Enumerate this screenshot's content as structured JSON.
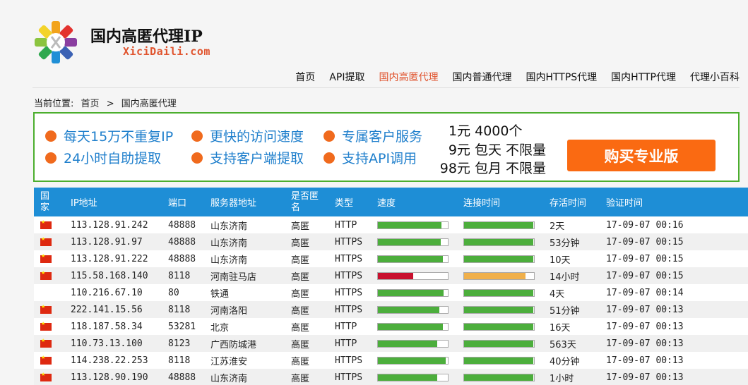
{
  "header": {
    "site_title": "国内高匿代理IP",
    "site_domain": "XiciDaili.com",
    "logo_icon": "xici-logo-icon"
  },
  "nav": {
    "items": [
      {
        "label": "首页"
      },
      {
        "label": "API提取"
      },
      {
        "label": "国内高匿代理",
        "active": true
      },
      {
        "label": "国内普通代理"
      },
      {
        "label": "国内HTTPS代理"
      },
      {
        "label": "国内HTTP代理"
      },
      {
        "label": "代理小百科"
      }
    ]
  },
  "breadcrumb": {
    "prefix": "当前位置:",
    "home": "首页",
    "separator": ">",
    "current": "国内高匿代理"
  },
  "banner": {
    "features": [
      "每天15万不重复IP",
      "24小时自助提取",
      "更快的访问速度",
      "支持客户端提取",
      "专属客户服务",
      "支持API调用"
    ],
    "prices": [
      "1元 4000个",
      "9元 包天 不限量",
      "98元 包月 不限量"
    ],
    "buy_label": "购买专业版",
    "accent_color": "#fa6a12",
    "feature_color": "#1f7fcc",
    "border_color": "#4cae2e"
  },
  "table": {
    "headers": {
      "country": "国家",
      "ip": "IP地址",
      "port": "端口",
      "location": "服务器地址",
      "anonymity": "是否匿名",
      "type": "类型",
      "speed": "速度",
      "connect": "连接时间",
      "alive": "存活时间",
      "verified": "验证时间"
    },
    "rows": [
      {
        "flag": "cn",
        "ip": "113.128.91.242",
        "port": "48888",
        "location": "山东济南",
        "anonymity": "高匿",
        "type": "HTTP",
        "speed_pct": 91,
        "speed_level": "fast",
        "connect_pct": 99,
        "connect_level": "fast",
        "alive": "2天",
        "verified": "17-09-07 00:16"
      },
      {
        "flag": "cn",
        "ip": "113.128.91.97",
        "port": "48888",
        "location": "山东济南",
        "anonymity": "高匿",
        "type": "HTTPS",
        "speed_pct": 90,
        "speed_level": "fast",
        "connect_pct": 99,
        "connect_level": "fast",
        "alive": "53分钟",
        "verified": "17-09-07 00:15"
      },
      {
        "flag": "cn",
        "ip": "113.128.91.222",
        "port": "48888",
        "location": "山东济南",
        "anonymity": "高匿",
        "type": "HTTPS",
        "speed_pct": 93,
        "speed_level": "fast",
        "connect_pct": 99,
        "connect_level": "fast",
        "alive": "10天",
        "verified": "17-09-07 00:15"
      },
      {
        "flag": "cn",
        "ip": "115.58.168.140",
        "port": "8118",
        "location": "河南驻马店",
        "anonymity": "高匿",
        "type": "HTTPS",
        "speed_pct": 50,
        "speed_level": "slow",
        "connect_pct": 88,
        "connect_level": "medium",
        "alive": "14小时",
        "verified": "17-09-07 00:15"
      },
      {
        "flag": "",
        "ip": "110.216.67.10",
        "port": "80",
        "location": "铁通",
        "anonymity": "高匿",
        "type": "HTTPS",
        "speed_pct": 94,
        "speed_level": "fast",
        "connect_pct": 99,
        "connect_level": "fast",
        "alive": "4天",
        "verified": "17-09-07 00:14"
      },
      {
        "flag": "cn",
        "ip": "222.141.15.56",
        "port": "8118",
        "location": "河南洛阳",
        "anonymity": "高匿",
        "type": "HTTPS",
        "speed_pct": 88,
        "speed_level": "fast",
        "connect_pct": 99,
        "connect_level": "fast",
        "alive": "51分钟",
        "verified": "17-09-07 00:13"
      },
      {
        "flag": "cn",
        "ip": "118.187.58.34",
        "port": "53281",
        "location": "北京",
        "anonymity": "高匿",
        "type": "HTTP",
        "speed_pct": 93,
        "speed_level": "fast",
        "connect_pct": 99,
        "connect_level": "fast",
        "alive": "16天",
        "verified": "17-09-07 00:13"
      },
      {
        "flag": "cn",
        "ip": "110.73.13.100",
        "port": "8123",
        "location": "广西防城港",
        "anonymity": "高匿",
        "type": "HTTP",
        "speed_pct": 85,
        "speed_level": "fast",
        "connect_pct": 99,
        "connect_level": "fast",
        "alive": "563天",
        "verified": "17-09-07 00:13"
      },
      {
        "flag": "cn",
        "ip": "114.238.22.253",
        "port": "8118",
        "location": "江苏淮安",
        "anonymity": "高匿",
        "type": "HTTPS",
        "speed_pct": 97,
        "speed_level": "fast",
        "connect_pct": 99,
        "connect_level": "fast",
        "alive": "40分钟",
        "verified": "17-09-07 00:13"
      },
      {
        "flag": "cn",
        "ip": "113.128.90.190",
        "port": "48888",
        "location": "山东济南",
        "anonymity": "高匿",
        "type": "HTTPS",
        "speed_pct": 85,
        "speed_level": "fast",
        "connect_pct": 99,
        "connect_level": "fast",
        "alive": "1小时",
        "verified": "17-09-07 00:13"
      }
    ]
  }
}
